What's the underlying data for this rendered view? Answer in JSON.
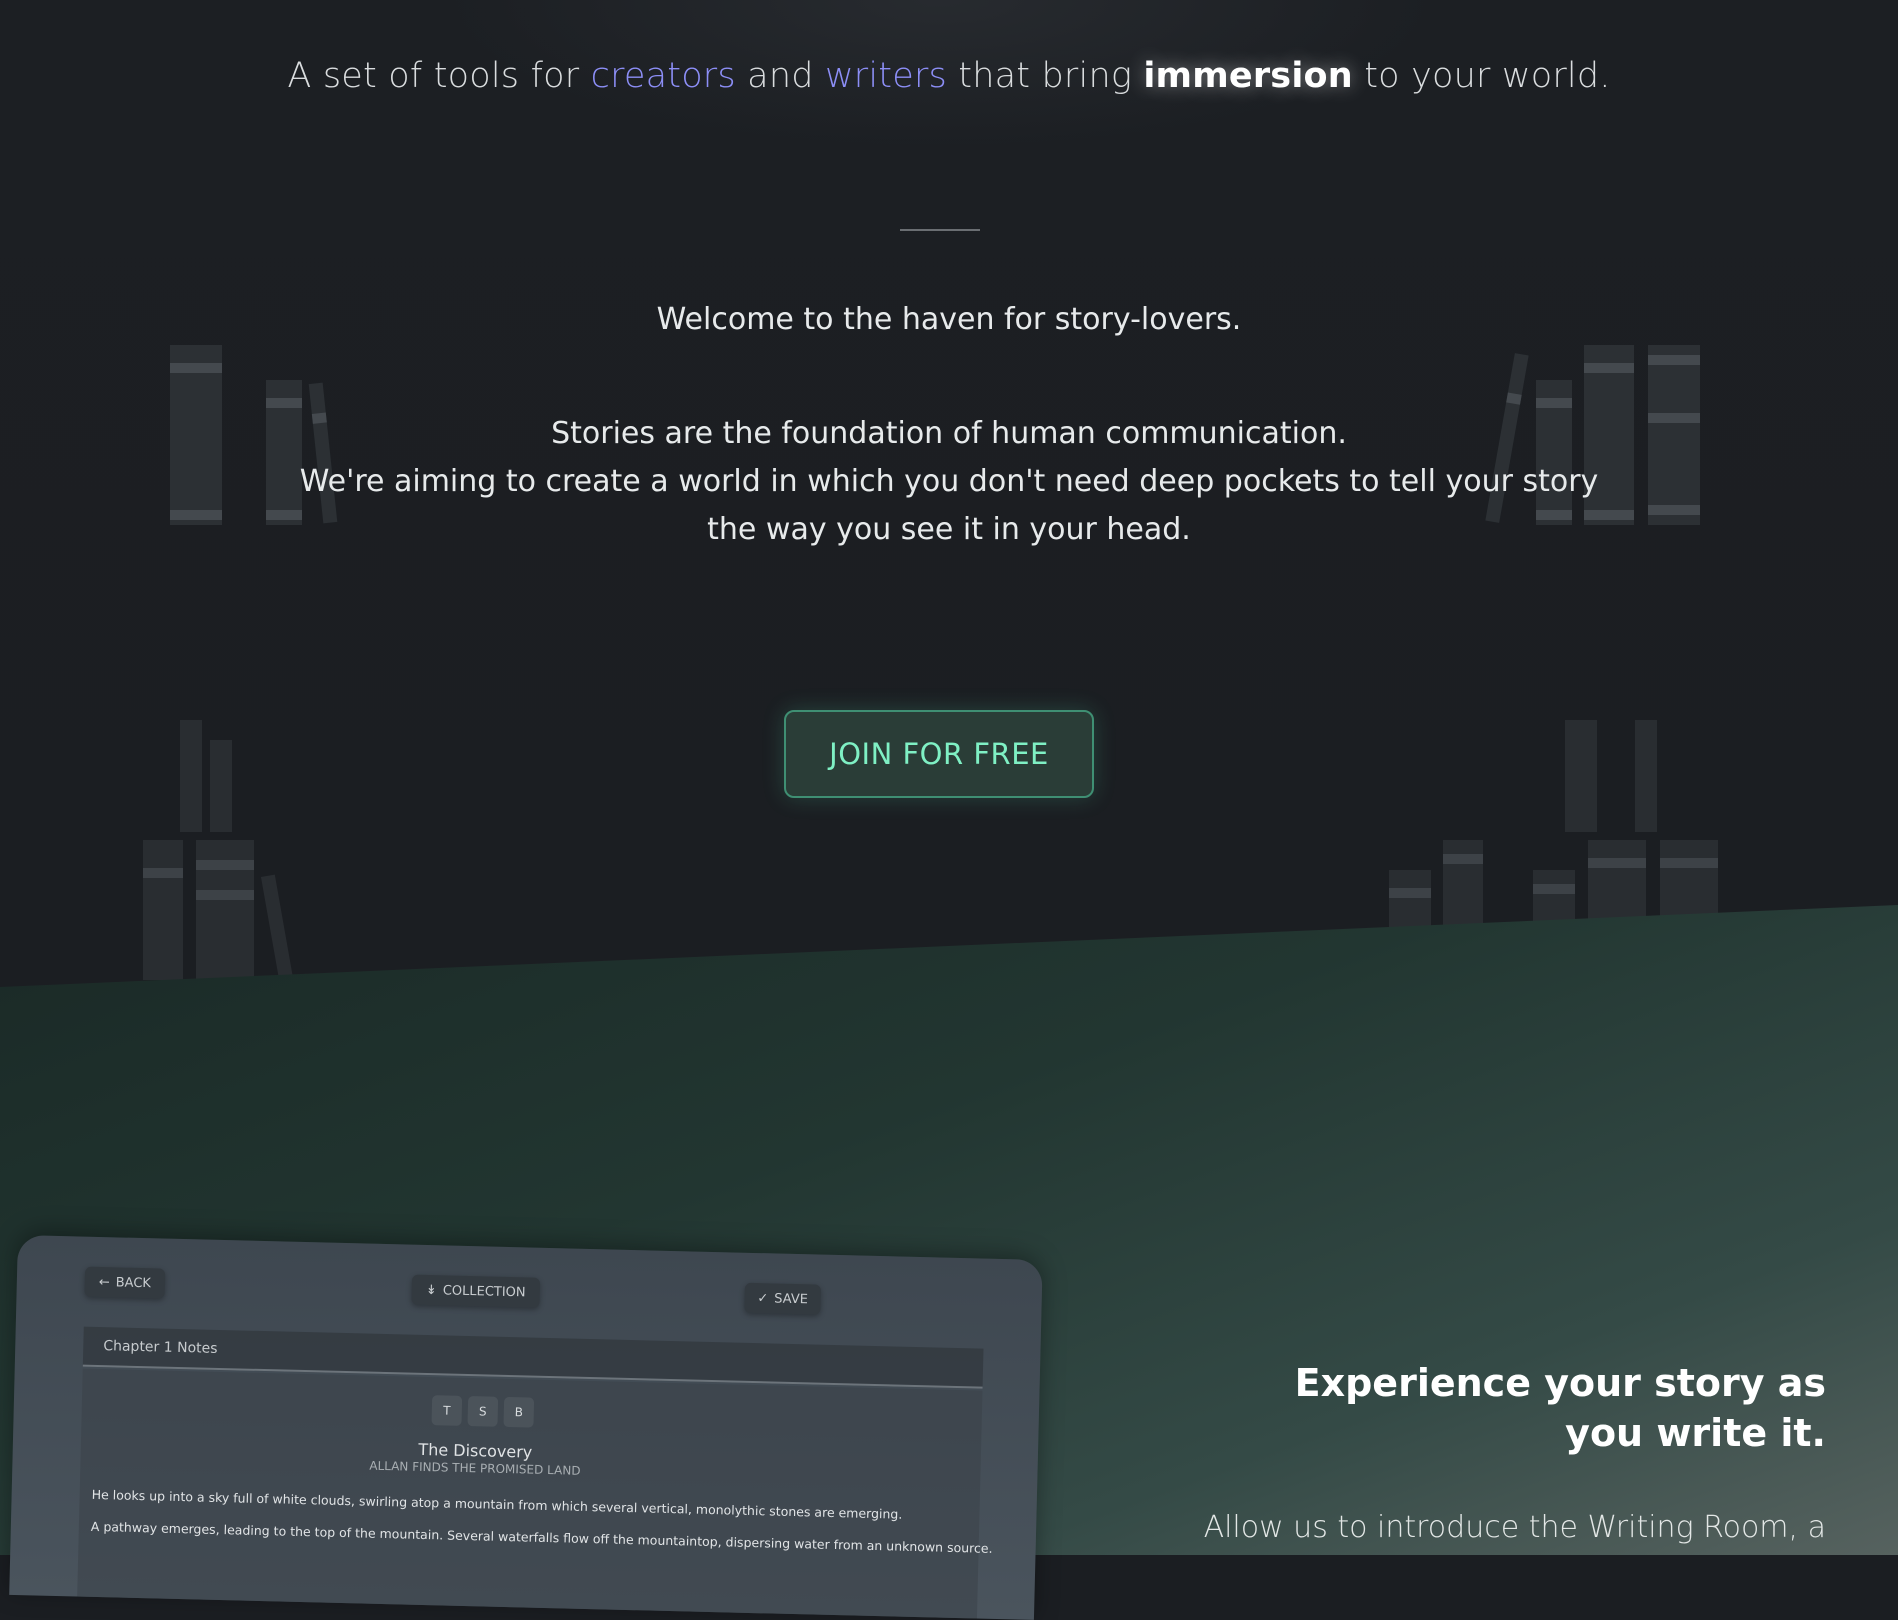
{
  "hero": {
    "tagline": {
      "part1": "A set of tools for ",
      "creators": "creators",
      "part2": " and ",
      "writers": "writers",
      "part3": " that bring ",
      "immersion": "immersion",
      "part4": " to your world."
    },
    "welcome": "Welcome to the haven for story-lovers.",
    "mission": [
      "Stories are the foundation of human communication.",
      "We're aiming to create a world in which you don't need deep pockets to tell your story",
      "the way you see it in your head."
    ],
    "join_button": "JOIN FOR FREE"
  },
  "writing_room_preview": {
    "back_label": "BACK",
    "collection_label": "COLLECTION",
    "save_label": "SAVE",
    "notes_title": "Chapter 1 Notes",
    "format_buttons": [
      "T",
      "S",
      "B"
    ],
    "doc_title": "The Discovery",
    "doc_subtitle": "ALLAN FINDS THE PROMISED LAND",
    "doc_lines": [
      "He looks up into a sky full of white clouds, swirling atop a mountain from which several vertical, monolythic stones are emerging.",
      "A pathway emerges, leading to the top of the mountain. Several waterfalls flow off the mountaintop, dispersing water from an unknown source."
    ]
  },
  "experience": {
    "title": "Experience your story as you write it.",
    "body": "Allow us to introduce the Writing Room, a"
  },
  "colors": {
    "background": "#1b1e22",
    "accent": "#8c8ef6",
    "button_text": "#7ff0c4",
    "button_border": "#3f8f73",
    "section_green": "#223631"
  }
}
